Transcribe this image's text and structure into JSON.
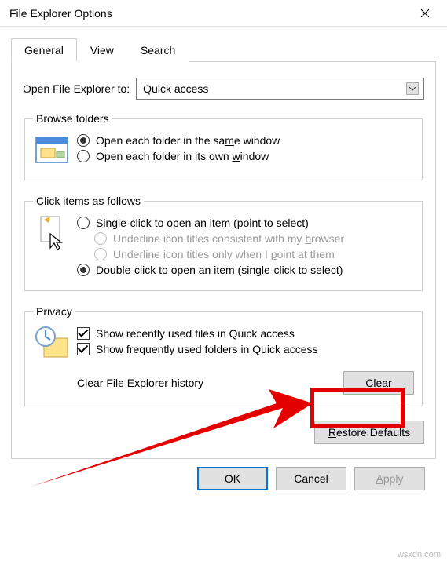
{
  "window": {
    "title": "File Explorer Options"
  },
  "tabs": {
    "general": "General",
    "view": "View",
    "search": "Search"
  },
  "open_explorer": {
    "label": "Open File Explorer to:",
    "value": "Quick access"
  },
  "browse_folders": {
    "legend": "Browse folders",
    "same_window": "Open each folder in the same window",
    "own_window": "Open each folder in its own window"
  },
  "click_items": {
    "legend": "Click items as follows",
    "single_click": "Single-click to open an item (point to select)",
    "underline_browser": "Underline icon titles consistent with my browser",
    "underline_point": "Underline icon titles only when I point at them",
    "double_click": "Double-click to open an item (single-click to select)"
  },
  "privacy": {
    "legend": "Privacy",
    "show_recent": "Show recently used files in Quick access",
    "show_frequent": "Show frequently used folders in Quick access",
    "clear_label": "Clear File Explorer history",
    "clear_btn": "Clear"
  },
  "buttons": {
    "restore": "Restore Defaults",
    "ok": "OK",
    "cancel": "Cancel",
    "apply": "Apply"
  },
  "watermark": "wsxdn.com"
}
